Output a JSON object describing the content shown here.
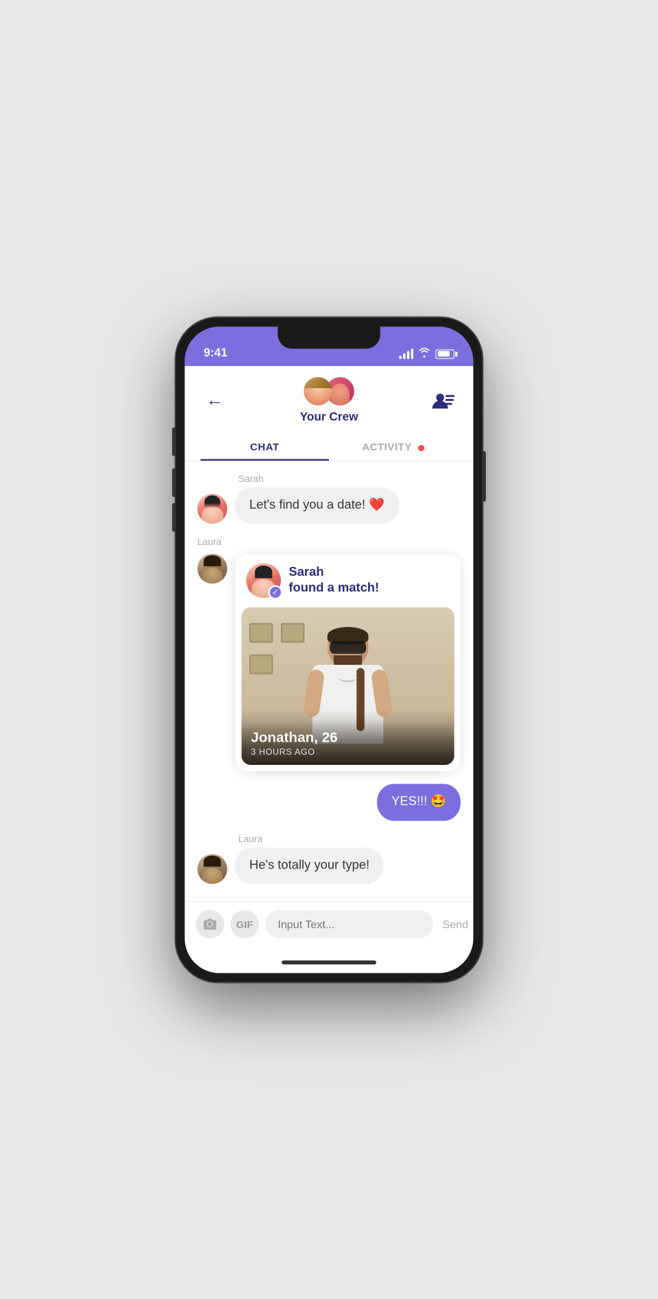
{
  "statusBar": {
    "time": "9:41",
    "batteryLevel": 80
  },
  "header": {
    "backLabel": "←",
    "crewTitle": "Your Crew",
    "tabs": [
      {
        "id": "chat",
        "label": "CHAT",
        "active": true,
        "hasDot": false
      },
      {
        "id": "activity",
        "label": "ACTIVITY",
        "active": false,
        "hasDot": true
      }
    ]
  },
  "messages": [
    {
      "id": "msg1",
      "sender": "Sarah",
      "type": "text",
      "text": "Let's find you a date! ❤️",
      "side": "left",
      "avatarType": "sarah"
    },
    {
      "id": "msg2",
      "sender": "Laura",
      "type": "card",
      "cardHeader": "Sarah\nfound a match!",
      "matchName": "Jonathan, 26",
      "matchTime": "3 HOURS AGO",
      "side": "left",
      "avatarType": "laura"
    },
    {
      "id": "msg3",
      "sender": "me",
      "type": "text",
      "text": "YES!!! 🤩",
      "side": "right"
    },
    {
      "id": "msg4",
      "sender": "Laura",
      "type": "text",
      "text": "He's totally your type!",
      "side": "left",
      "avatarType": "laura"
    }
  ],
  "inputBar": {
    "placeholder": "Input Text...",
    "sendLabel": "Send",
    "gifLabel": "GIF"
  }
}
